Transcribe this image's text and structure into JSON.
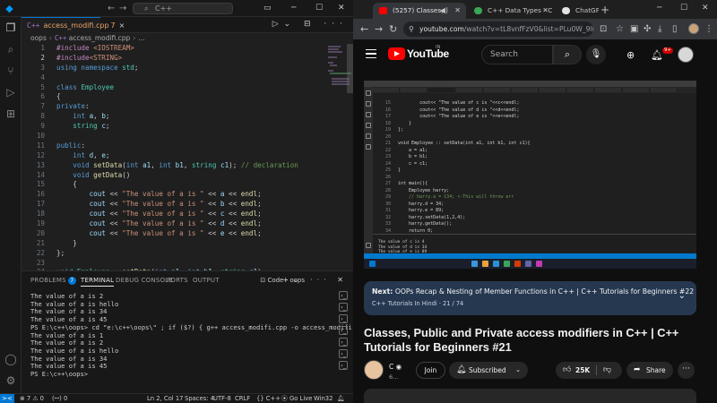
{
  "vscode": {
    "title_nav_back": "←",
    "title_nav_fwd": "→",
    "command_center": "C++",
    "tab": {
      "icon": "C++",
      "label": "access_modifi.cpp",
      "problems": "7",
      "close": "×"
    },
    "breadcrumb": {
      "folder": "oops",
      "file_icon": "C++",
      "file": "access_modifi.cpp",
      "more": "..."
    },
    "code_lines": [
      {
        "n": "1",
        "html": "<span class='pp'>#include</span> <span class='hd'>&lt;IOSTREAM&gt;</span>"
      },
      {
        "n": "2",
        "html": "<span class='pp'>#include</span><span class='hd'>&lt;STRING&gt;</span>"
      },
      {
        "n": "3",
        "html": "<span class='kw'>using namespace</span> <span class='ty'>std</span>;"
      },
      {
        "n": "4",
        "html": ""
      },
      {
        "n": "5",
        "html": "<span class='kw'>class</span> <span class='ty'>Employee</span>"
      },
      {
        "n": "6",
        "html": "{"
      },
      {
        "n": "7",
        "html": "<span class='kw'>private</span>:"
      },
      {
        "n": "8",
        "html": "    <span class='kw'>int</span> <span class='va'>a</span>, <span class='va'>b</span>;"
      },
      {
        "n": "9",
        "html": "    <span class='ty'>string</span> <span class='va'>c</span>;"
      },
      {
        "n": "10",
        "html": ""
      },
      {
        "n": "11",
        "html": "<span class='kw'>public</span>:"
      },
      {
        "n": "12",
        "html": "    <span class='kw'>int</span> <span class='va'>d</span>, <span class='va'>e</span>;"
      },
      {
        "n": "13",
        "html": "    <span class='kw'>void</span> <span class='fn'>setData</span>(<span class='kw'>int</span> <span class='va'>a1</span>, <span class='kw'>int</span> <span class='va'>b1</span>, <span class='ty'>string</span> <span class='va'>c1</span>); <span class='cm'>// declaration</span>"
      },
      {
        "n": "14",
        "html": "    <span class='kw'>void</span> <span class='fn'>getData</span>()"
      },
      {
        "n": "15",
        "html": "    {"
      },
      {
        "n": "16",
        "html": "        <span class='va'>cout</span> &lt;&lt; <span class='st'>\"The value of a is \"</span> &lt;&lt; <span class='va'>a</span> &lt;&lt; <span class='fn'>endl</span>;"
      },
      {
        "n": "17",
        "html": "        <span class='va'>cout</span> &lt;&lt; <span class='st'>\"The value of a is \"</span> &lt;&lt; <span class='va'>b</span> &lt;&lt; <span class='fn'>endl</span>;"
      },
      {
        "n": "18",
        "html": "        <span class='va'>cout</span> &lt;&lt; <span class='st'>\"The value of a is \"</span> &lt;&lt; <span class='va'>c</span> &lt;&lt; <span class='fn'>endl</span>;"
      },
      {
        "n": "19",
        "html": "        <span class='va'>cout</span> &lt;&lt; <span class='st'>\"The value of a is \"</span> &lt;&lt; <span class='va'>d</span> &lt;&lt; <span class='fn'>endl</span>;"
      },
      {
        "n": "20",
        "html": "        <span class='va'>cout</span> &lt;&lt; <span class='st'>\"The value of a is \"</span> &lt;&lt; <span class='va'>e</span> &lt;&lt; <span class='fn'>endl</span>;"
      },
      {
        "n": "21",
        "html": "    }"
      },
      {
        "n": "22",
        "html": "};"
      },
      {
        "n": "23",
        "html": ""
      },
      {
        "n": "24",
        "html": "<span class='kw'>void</span> <span class='ty'>Employee</span> ::<span class='fn'>setData</span>(<span class='kw'>int</span> <span class='va'>a1</span>, <span class='kw'>int</span> <span class='va'>b1</span>, <span class='ty'>string</span> <span class='va'>c1</span>)"
      }
    ],
    "panel_tabs": {
      "problems": "PROBLEMS",
      "problems_count": "7",
      "terminal": "TERMINAL",
      "debug": "DEBUG CONSOLE",
      "ports": "PORTS",
      "output": "OUTPUT"
    },
    "terminal_name": "Code - oops",
    "terminal_lines": [
      "The value of a is 2",
      "The value of a is hello",
      "The value of a is 34",
      "The value of a is 45",
      "PS E:\\c++\\oops> cd \"e:\\c++\\oops\\\" ; if ($?) { g++ access_modifi.cpp -o access_modifi } ; if ($?) { .\\access_modifi }",
      "The value of a is 1",
      "The value of a is 2",
      "The value of a is hello",
      "The value of a is 34",
      "The value of a is 45",
      "PS E:\\c++\\oops> "
    ],
    "status": {
      "remote": "><",
      "errors": "⊗ 7 ⚠ 0",
      "ports": "(ꟷ) 0",
      "position": "Ln 2, Col 17",
      "spaces": "Spaces: 4",
      "encoding": "UTF-8",
      "eol": "CRLF",
      "lang": "{} C++",
      "golive": "⦿ Go Live",
      "platform": "Win32"
    }
  },
  "browser": {
    "tabs": [
      {
        "label": "(5257) Classes,",
        "active": true,
        "fav_color": "#ff0000"
      },
      {
        "label": "C++ Data Types - C",
        "active": false,
        "fav_color": "#3aa757"
      },
      {
        "label": "ChatGPT",
        "active": false,
        "fav_color": "#e3e3e3"
      }
    ],
    "url_host": "youtube.com",
    "url_path": "/watch?v=tL8vnfFzV0&list=PLu0W_9lII9...",
    "youtube": {
      "logo_text": "YouTube",
      "region": "IN",
      "search_placeholder": "Search",
      "notification_count": "9+",
      "player_caption": {
        "code_lines": [
          {
            "n": "15",
            "t": "        cout<< \"The value of c is \"<<c<<endl;"
          },
          {
            "n": "16",
            "t": "        cout<< \"The value of d is \"<<d<<endl;"
          },
          {
            "n": "17",
            "t": "        cout<< \"The value of e is \"<<e<<endl;"
          },
          {
            "n": "18",
            "t": "    }"
          },
          {
            "n": "19",
            "t": "};"
          },
          {
            "n": "20",
            "t": ""
          },
          {
            "n": "21",
            "t": "void Employee :: setData(int a1, int b1, int c1){"
          },
          {
            "n": "22",
            "t": "    a = a1;"
          },
          {
            "n": "23",
            "t": "    b = b1;"
          },
          {
            "n": "24",
            "t": "    c = c1;"
          },
          {
            "n": "25",
            "t": "}"
          },
          {
            "n": "26",
            "t": ""
          },
          {
            "n": "27",
            "t": "int main(){"
          },
          {
            "n": "28",
            "t": "    Employee harry;"
          },
          {
            "n": "29",
            "t": "    // harry.a = 134; <-This will throw err"
          },
          {
            "n": "30",
            "t": "    harry.d = 34;"
          },
          {
            "n": "31",
            "t": "    harry.e = 89;"
          },
          {
            "n": "32",
            "t": "    harry.setData(1,2,4);"
          },
          {
            "n": "33",
            "t": "    harry.getData();"
          },
          {
            "n": "34",
            "t": "    return 0;"
          },
          {
            "n": "35",
            "t": "}"
          }
        ],
        "term_lines": [
          "The value of c is 4",
          "The value of d is 34",
          "The value of e is 89"
        ]
      },
      "next": {
        "prefix": "Next:",
        "title": "OOPs Recap & Nesting of Member Functions in C++ | C++ Tutorials for Beginners #22",
        "playlist": "C++ Tutorials In Hindi · 21 / 74"
      },
      "video_title": "Classes, Public and Private access modifiers in C++ | C++ Tutorials for Beginners #21",
      "channel_name": "C",
      "channel_subs": "6...",
      "join": "Join",
      "subscribed": "Subscribed",
      "likes": "25K",
      "share": "Share"
    }
  },
  "colors": {
    "vscode_accent": "#0078d4",
    "youtube_red": "#ff0000",
    "next_card": "#263850"
  }
}
